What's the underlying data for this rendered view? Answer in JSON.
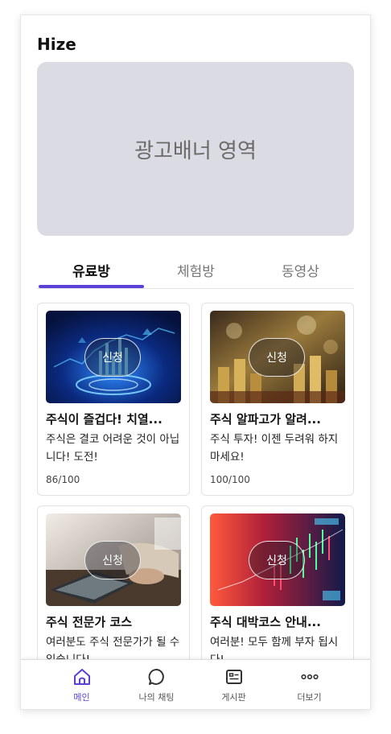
{
  "app": {
    "title": "Hize"
  },
  "banner": {
    "text": "광고배너 영역"
  },
  "tabs": [
    {
      "label": "유료방",
      "active": true
    },
    {
      "label": "체험방",
      "active": false
    },
    {
      "label": "동영상",
      "active": false
    }
  ],
  "cards": [
    {
      "title": "주식이 즐겁다! 치열...",
      "desc": "주식은 결코 어려운 것이 아닙니다! 도전!",
      "count": "86/100",
      "button": "신청"
    },
    {
      "title": "주식 알파고가 알려...",
      "desc": "주식 투자! 이젠 두려워 하지 마세요!",
      "count": "100/100",
      "button": "신청"
    },
    {
      "title": "주식 전문가 코스",
      "desc": "여러분도 주식 전문가가 될 수 있습니다!",
      "button": "신청"
    },
    {
      "title": "주식 대박코스 안내...",
      "desc": "여러분! 모두 함께 부자 됩시다!",
      "button": "신청"
    }
  ],
  "nav": [
    {
      "label": "메인",
      "icon": "home-icon",
      "active": true
    },
    {
      "label": "나의 채팅",
      "icon": "chat-bubble-icon",
      "active": false
    },
    {
      "label": "게시판",
      "icon": "board-icon",
      "active": false
    },
    {
      "label": "더보기",
      "icon": "more-dots-icon",
      "active": false
    }
  ],
  "colors": {
    "accent": "#5b3fd6",
    "banner_bg": "#dadbe3"
  }
}
